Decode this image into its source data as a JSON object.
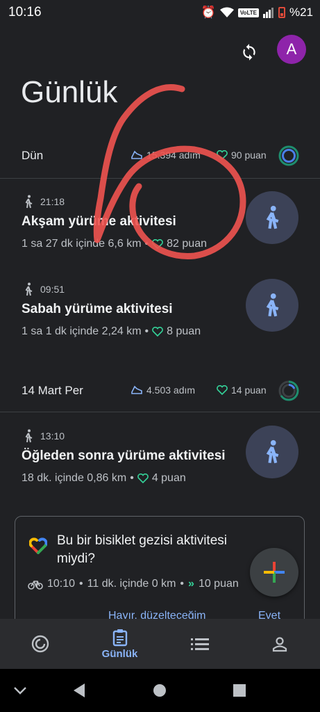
{
  "status_bar": {
    "time": "10:16",
    "volte": "VoLTE",
    "battery": "%21"
  },
  "header": {
    "title": "Günlük",
    "avatar_letter": "A"
  },
  "days": [
    {
      "label": "Dün",
      "steps": "15.394 adım",
      "points": "90 puan"
    },
    {
      "label": "14 Mart Per",
      "steps": "4.503 adım",
      "points": "14 puan"
    }
  ],
  "activities": [
    {
      "time": "21:18",
      "title": "Akşam yürüme aktivitesi",
      "meta": "1 sa 27 dk içinde 6,6 km",
      "points": "82 puan"
    },
    {
      "time": "09:51",
      "title": "Sabah yürüme aktivitesi",
      "meta": "1 sa 1 dk içinde 2,24 km",
      "points": "8 puan"
    },
    {
      "time": "13:10",
      "title": "Öğleden sonra yürüme aktivitesi",
      "meta": "18 dk. içinde 0,86 km",
      "points": "4 puan"
    }
  ],
  "suggestion_card": {
    "question": "Bu bir bisiklet gezisi aktivitesi miydi?",
    "time": "10:10",
    "meta": "11 dk. içinde 0 km",
    "points": "10 puan",
    "no_label": "Hayır, düzelteceğim",
    "yes_label": "Evet"
  },
  "bottom_nav": {
    "journal_label": "Günlük"
  },
  "colors": {
    "accent": "#8ab4f8",
    "heart": "#34d399",
    "background": "#202124",
    "avatar": "#8e24aa",
    "scribble": "#ef5350"
  }
}
